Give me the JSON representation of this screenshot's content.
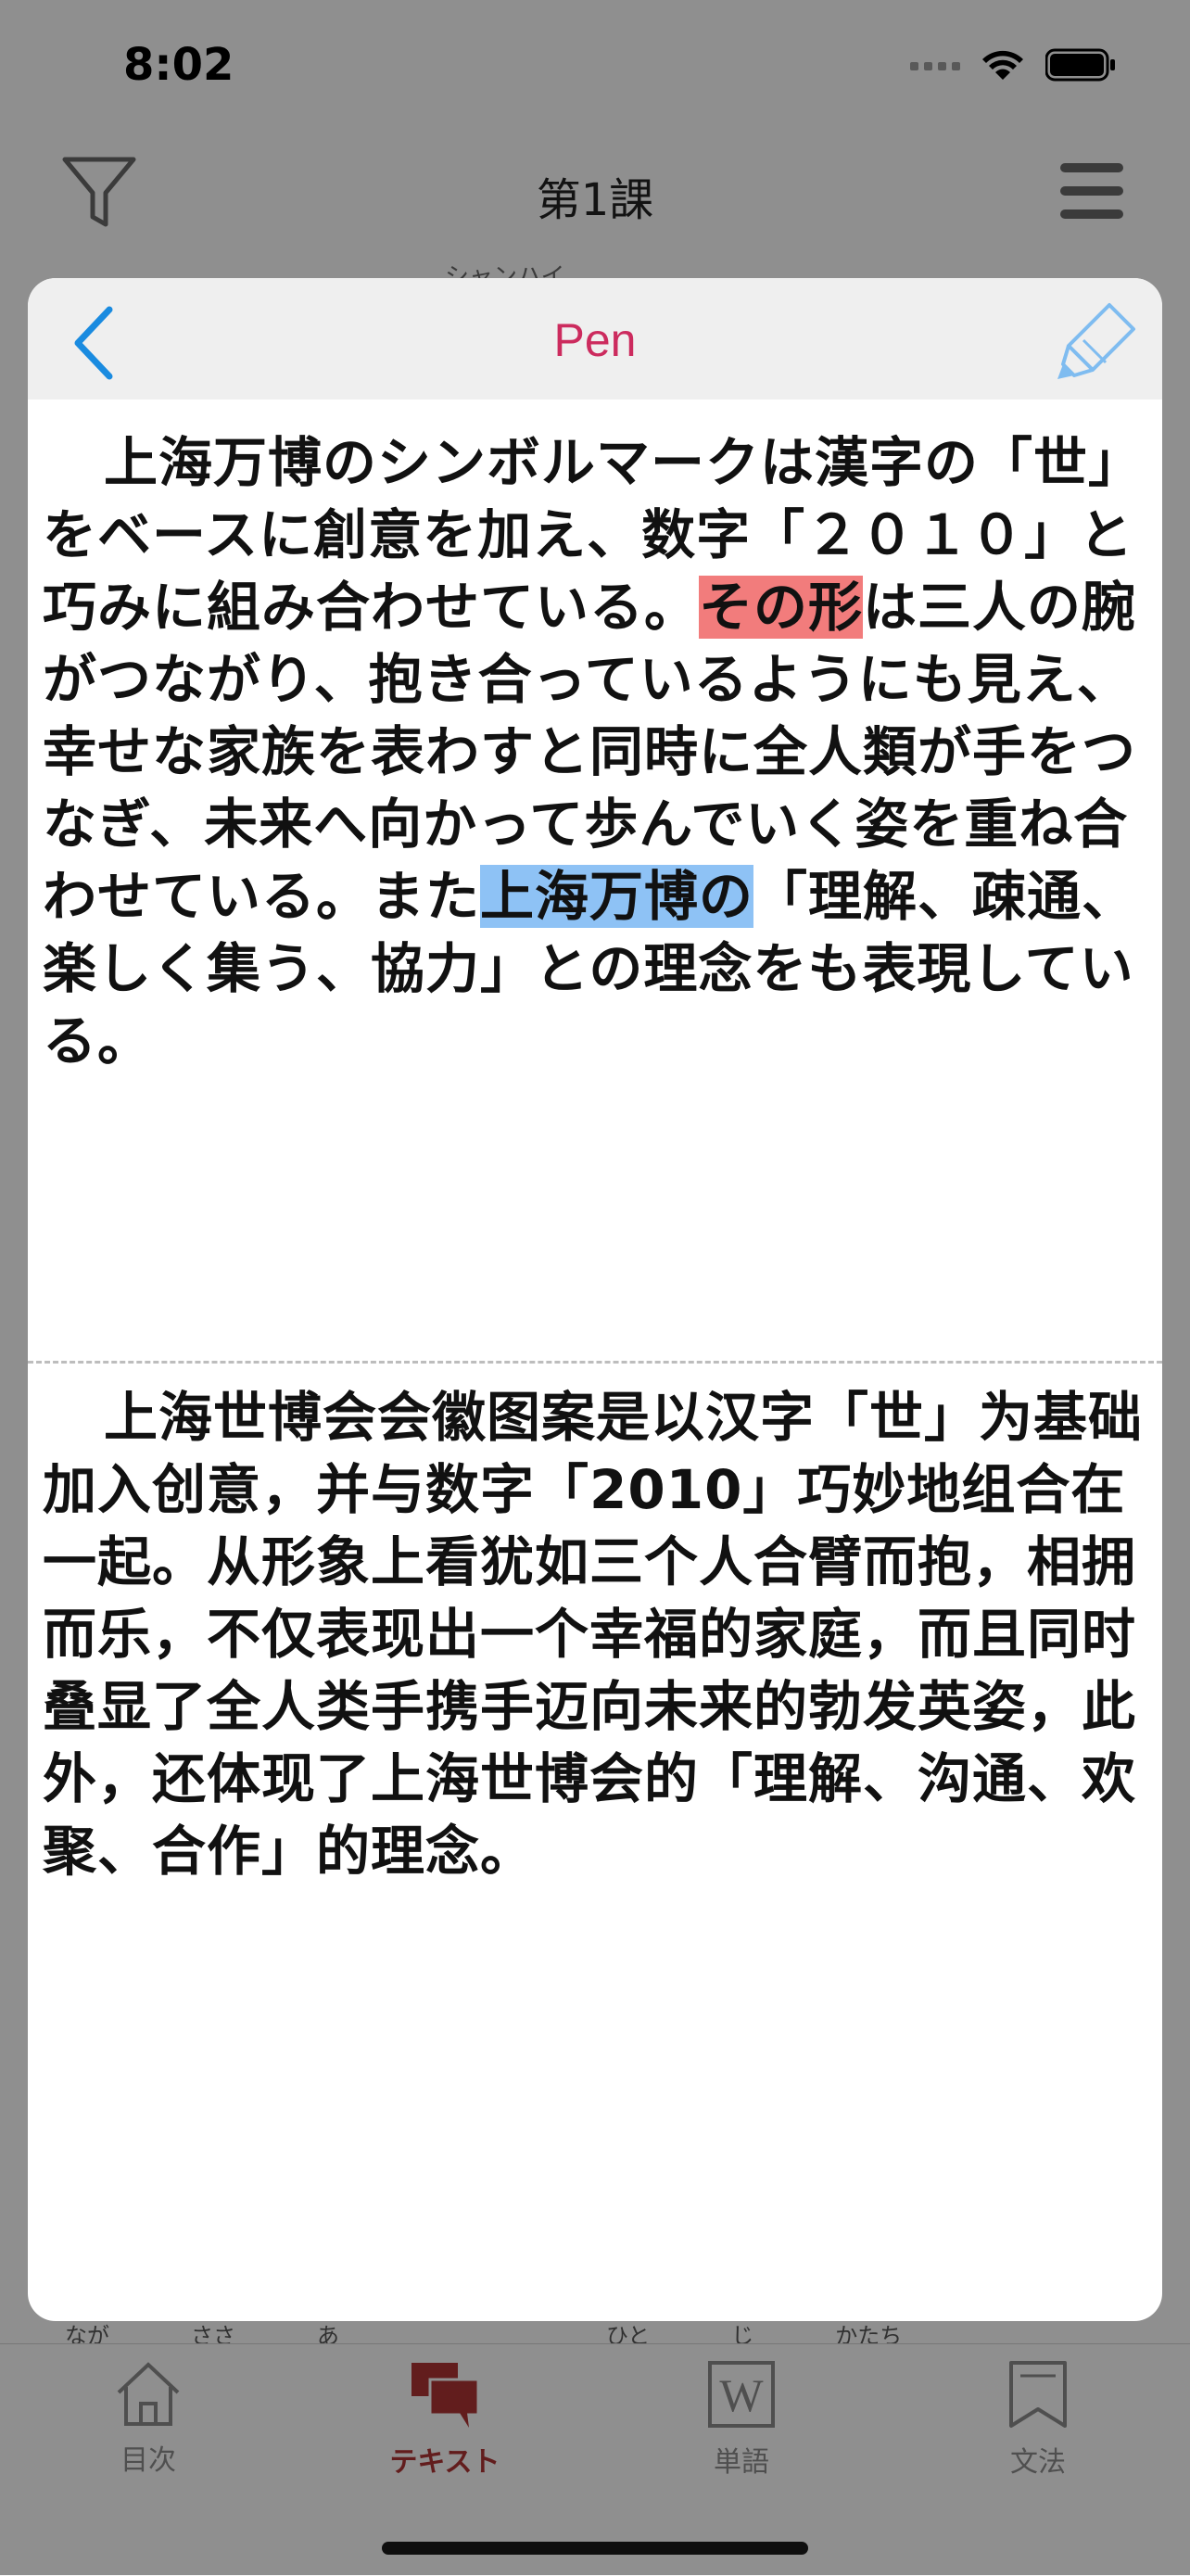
{
  "status_bar": {
    "time": "8:02"
  },
  "background": {
    "nav_title": "第1課",
    "furigana_peek": "シャンハイ",
    "bottom_furigana": [
      "なが",
      "ささ",
      "あ",
      "ひと",
      "じ",
      "かたち"
    ],
    "tabs": [
      {
        "label": "目次",
        "icon": "house-icon"
      },
      {
        "label": "テキスト",
        "icon": "chat-bubbles-icon",
        "active": true
      },
      {
        "label": "単語",
        "icon": "w-book-icon"
      },
      {
        "label": "文法",
        "icon": "bookmark-icon"
      }
    ]
  },
  "modal": {
    "title": "Pen",
    "japanese": {
      "segments": [
        {
          "text": "上海万博のシンボルマークは漢字の「世」をベースに創意を加え、数字「２０１０」と巧みに組み合わせている。",
          "highlight": "none"
        },
        {
          "text": "その形",
          "highlight": "red"
        },
        {
          "text": "は三人の腕がつながり、抱き合っているようにも見え、幸せな家族を表わすと同時に全人類が手をつなぎ、未来へ向かって歩んでいく姿を重ね合わせている。また",
          "highlight": "none"
        },
        {
          "text": "上海万博の",
          "highlight": "blue"
        },
        {
          "text": "「理解、疎通、楽しく集う、協力」との理念をも表現している。",
          "highlight": "none"
        }
      ]
    },
    "chinese": "上海世博会会徽图案是以汉字「世」为基础加入创意，并与数字「2010」巧妙地组合在一起。从形象上看犹如三个人合臂而抱，相拥而乐，不仅表现出一个幸福的家庭，而且同时叠显了全人类手携手迈向未来的勃发英姿，此外，还体现了上海世博会的「理解、沟通、欢聚、合作」的理念。"
  },
  "colors": {
    "title_accent": "#cc2b5e",
    "back_arrow": "#1a8be0",
    "highlight_red": "#f27c7c",
    "highlight_blue": "#8ec2f5",
    "active_tab": "#a33333"
  }
}
